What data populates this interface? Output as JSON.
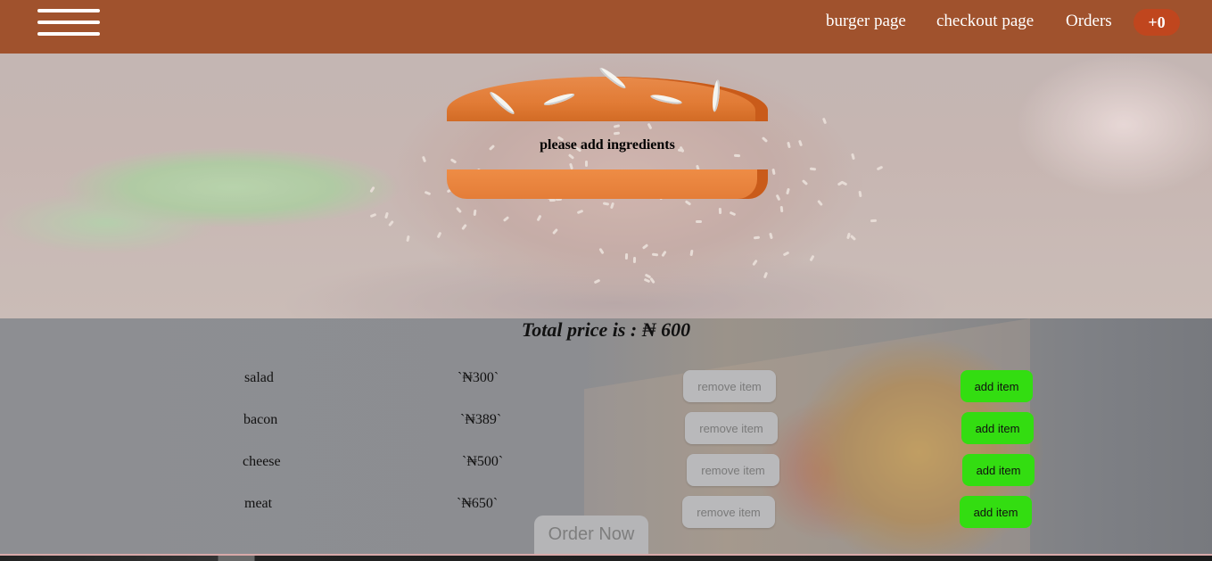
{
  "navbar": {
    "menu_icon": "hamburger-menu-icon",
    "links": {
      "burger": "burger page",
      "checkout": "checkout page",
      "orders": "Orders"
    },
    "cart_count": "+0",
    "bg_color": "#a0522d"
  },
  "builder": {
    "message": "please add ingredients"
  },
  "summary": {
    "total_label": "Total price is : ₦ 600"
  },
  "ingredients": [
    {
      "name": "salad",
      "price": "`₦300`",
      "remove_label": "remove item",
      "add_label": "add item"
    },
    {
      "name": "bacon",
      "price": "`₦389`",
      "remove_label": "remove item",
      "add_label": "add item"
    },
    {
      "name": "cheese",
      "price": "`₦500`",
      "remove_label": "remove item",
      "add_label": "add item"
    },
    {
      "name": "meat",
      "price": "`₦650`",
      "remove_label": "remove item",
      "add_label": "add item"
    }
  ],
  "order_button": "Order Now",
  "colors": {
    "add_button": "#33dd11",
    "remove_button": "#b9b9bb",
    "bun": "#e17b35"
  }
}
